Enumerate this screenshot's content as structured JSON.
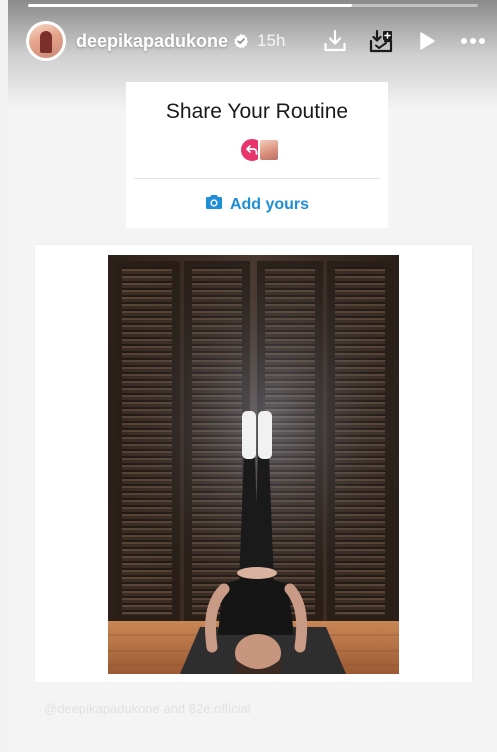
{
  "story": {
    "progress_fraction": 0.72,
    "username": "deepikapadukone",
    "time": "15h",
    "verified": true
  },
  "header_icons": [
    "download-icon",
    "add-to-highlight-icon",
    "play-icon",
    "more-options-icon"
  ],
  "sticker": {
    "title": "Share Your Routine",
    "action_label": "Add yours",
    "action_icon": "camera-icon"
  },
  "photo": {
    "subject": "woman-legs-up-wall-yoga-pose"
  },
  "credit": "@deepikapadukone and 82e.official",
  "colors": {
    "accent": "#1e8ed6",
    "reply_badge": "#e8336b",
    "door_wood": "#3a2c22",
    "floor_wood": "#b06c3f"
  }
}
